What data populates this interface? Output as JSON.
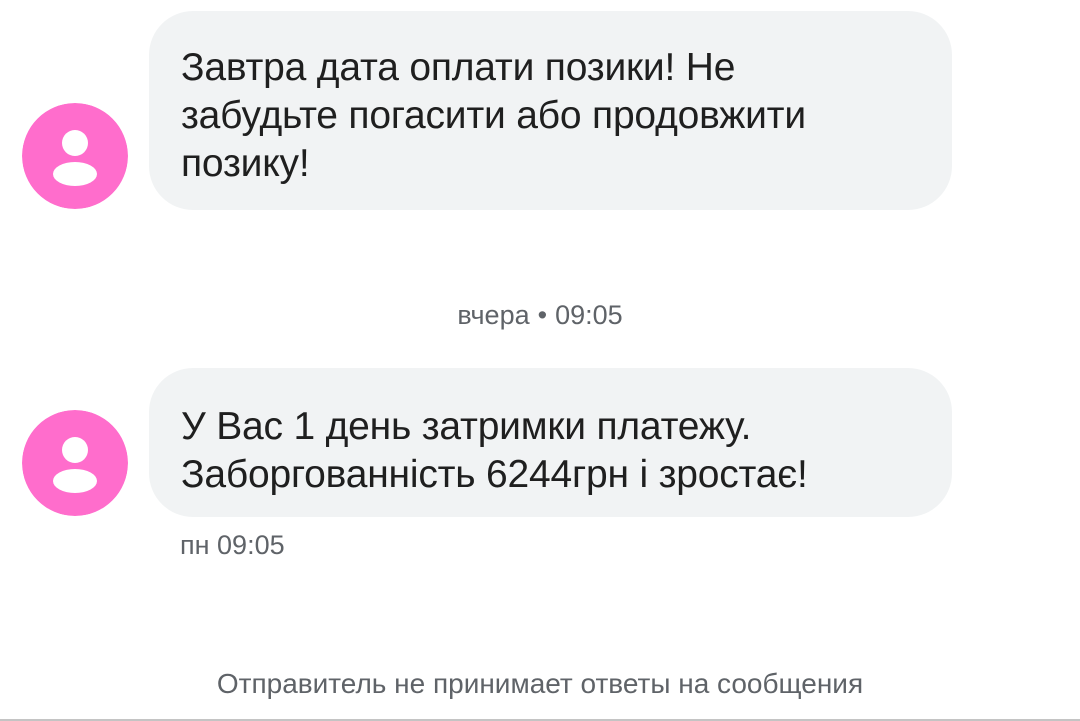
{
  "colors": {
    "avatar": "#ff6dcc",
    "bubble": "#f1f3f4",
    "text": "#1f1f1f",
    "meta_text": "#5f6368"
  },
  "messages": [
    {
      "avatar_icon": "person-icon",
      "lines": [
        "Завтра дата оплати позики! Не",
        "забудьте погасити або продовжити",
        "позику!"
      ]
    },
    {
      "avatar_icon": "person-icon",
      "lines": [
        "У Вас 1 день затримки платежу.",
        "Заборгованність 6244грн і зростає!"
      ],
      "time": "пн 09:05"
    }
  ],
  "separator": {
    "day": "вчера",
    "dot": "•",
    "time": "09:05"
  },
  "footer": {
    "notice": "Отправитель не принимает ответы на сообщения"
  }
}
